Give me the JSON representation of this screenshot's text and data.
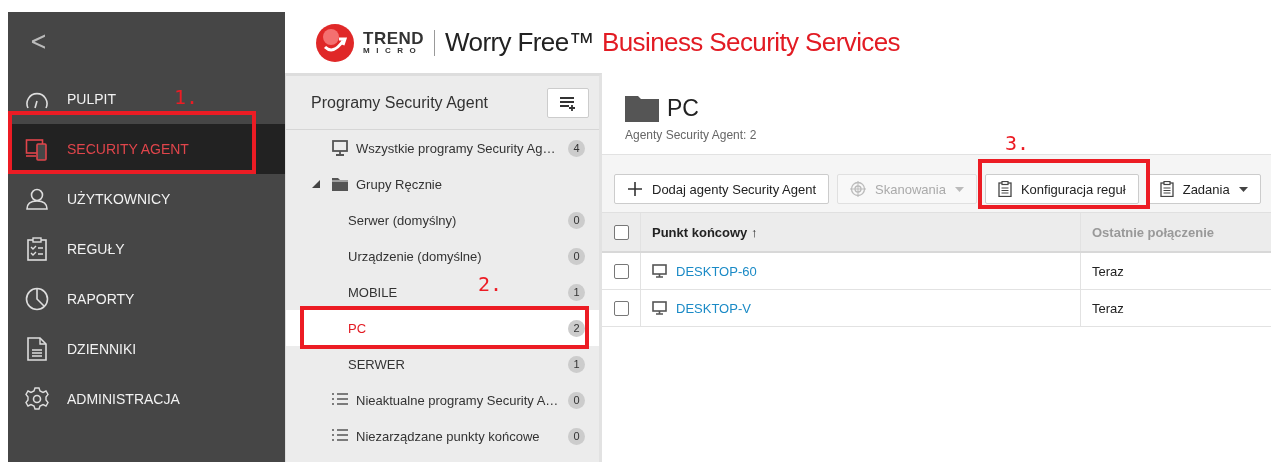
{
  "sidebar": {
    "back_label": "<",
    "items": [
      {
        "label": "PULPIT",
        "selected": false
      },
      {
        "label": "SECURITY AGENT",
        "selected": true,
        "annotation": "1."
      },
      {
        "label": "UŻYTKOWNICY",
        "selected": false
      },
      {
        "label": "REGUŁY",
        "selected": false
      },
      {
        "label": "RAPORTY",
        "selected": false
      },
      {
        "label": "DZIENNIKI",
        "selected": false
      },
      {
        "label": "ADMINISTRACJA",
        "selected": false
      }
    ]
  },
  "header": {
    "logo_top": "TREND",
    "logo_bottom": "MICRO",
    "product": "Worry Free™",
    "product_suffix": "Business Security Services"
  },
  "groups_panel": {
    "title": "Programy Security Agent",
    "tree": [
      {
        "kind": "all",
        "label": "Wszystkie programy Security Ag…",
        "count": "4",
        "selected": false
      },
      {
        "kind": "group",
        "label": "Grupy Ręcznie",
        "expanded": true,
        "selected": false,
        "children": [
          {
            "kind": "leaf",
            "label": "Serwer (domyślny)",
            "count": "0",
            "selected": false
          },
          {
            "kind": "leaf",
            "label": "Urządzenie (domyślne)",
            "count": "0",
            "selected": false
          },
          {
            "kind": "leaf",
            "label": "MOBILE",
            "count": "1",
            "selected": false
          },
          {
            "kind": "leaf",
            "label": "PC",
            "count": "2",
            "selected": true,
            "annotation": "2."
          },
          {
            "kind": "leaf",
            "label": "SERWER",
            "count": "1",
            "selected": false
          }
        ]
      },
      {
        "kind": "list",
        "label": "Nieaktualne programy Security A…",
        "count": "0",
        "selected": false
      },
      {
        "kind": "list",
        "label": "Niezarządzane punkty końcowe",
        "count": "0",
        "selected": false
      }
    ]
  },
  "content": {
    "title": "PC",
    "subtitle": "Agenty Security Agent: 2",
    "toolbar": [
      {
        "label": "Dodaj agenty Security Agent",
        "disabled": false,
        "dropdown": false
      },
      {
        "label": "Skanowania",
        "disabled": true,
        "dropdown": true
      },
      {
        "label": "Konfiguracja reguł",
        "disabled": false,
        "dropdown": false,
        "annotation": "3."
      },
      {
        "label": "Zadania",
        "disabled": false,
        "dropdown": true
      }
    ],
    "table": {
      "header_checked": false,
      "columns": [
        {
          "label": "Punkt końcowy ↑",
          "sorted": true
        },
        {
          "label": "Ostatnie połączenie",
          "sorted": false
        }
      ],
      "rows": [
        {
          "checked": false,
          "endpoint": "DESKTOP-60",
          "last_connection": "Teraz"
        },
        {
          "checked": false,
          "endpoint": "DESKTOP-V",
          "last_connection": "Teraz"
        }
      ]
    }
  }
}
